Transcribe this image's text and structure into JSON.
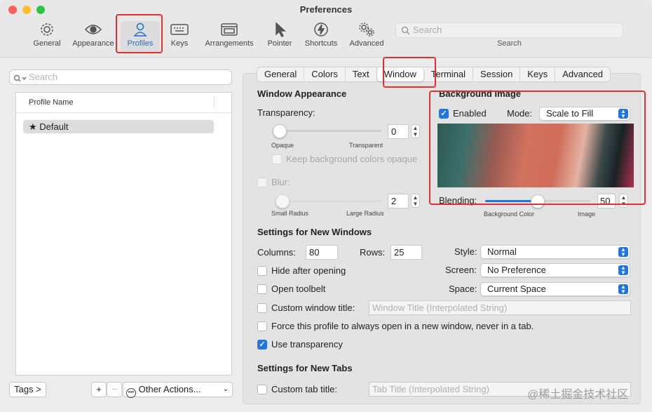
{
  "window": {
    "title": "Preferences"
  },
  "toolbar": {
    "items": [
      {
        "label": "General",
        "icon": "gear-icon"
      },
      {
        "label": "Appearance",
        "icon": "eye-icon"
      },
      {
        "label": "Profiles",
        "icon": "person-icon",
        "selected": true
      },
      {
        "label": "Keys",
        "icon": "keyboard-icon"
      },
      {
        "label": "Arrangements",
        "icon": "windows-icon"
      },
      {
        "label": "Pointer",
        "icon": "pointer-icon"
      },
      {
        "label": "Shortcuts",
        "icon": "lightning-icon"
      },
      {
        "label": "Advanced",
        "icon": "gears-icon"
      }
    ],
    "search": {
      "placeholder": "Search",
      "label": "Search"
    }
  },
  "sidebar": {
    "search_placeholder": "Search",
    "column_header": "Profile Name",
    "profiles": [
      {
        "name": "Default",
        "star": "★"
      }
    ],
    "tags_button": "Tags >",
    "add_button": "+",
    "remove_button": "−",
    "other_actions": "Other Actions..."
  },
  "tabs": [
    "General",
    "Colors",
    "Text",
    "Window",
    "Terminal",
    "Session",
    "Keys",
    "Advanced"
  ],
  "selected_tab": "Window",
  "window_appearance": {
    "heading": "Window Appearance",
    "transparency_label": "Transparency:",
    "transparency_value": "0",
    "opaque": "Opaque",
    "transparent": "Transparent",
    "keep_opaque": "Keep background colors opaque",
    "blur_label": "Blur:",
    "blur_value": "2",
    "small_radius": "Small Radius",
    "large_radius": "Large Radius"
  },
  "background_image": {
    "heading": "Background Image",
    "enabled_label": "Enabled",
    "enabled": true,
    "mode_label": "Mode:",
    "mode_value": "Scale to Fill",
    "blending_label": "Blending:",
    "blending_value": "50",
    "blending_fraction": 0.5,
    "background_color": "Background Color",
    "image": "Image"
  },
  "new_windows": {
    "heading": "Settings for New Windows",
    "columns_label": "Columns:",
    "columns": "80",
    "rows_label": "Rows:",
    "rows": "25",
    "style_label": "Style:",
    "style": "Normal",
    "screen_label": "Screen:",
    "screen": "No Preference",
    "space_label": "Space:",
    "space": "Current Space",
    "hide_after_opening": "Hide after opening",
    "open_toolbelt": "Open toolbelt",
    "custom_title": "Custom window title:",
    "title_placeholder": "Window Title (Interpolated String)",
    "force_window": "Force this profile to always open in a new window, never in a tab.",
    "use_transparency": "Use transparency"
  },
  "new_tabs": {
    "heading": "Settings for New Tabs",
    "custom_tab_title": "Custom tab title:",
    "tab_title_placeholder": "Tab Title (Interpolated String)"
  },
  "watermark": "@稀土掘金技术社区",
  "colors": {
    "accent": "#1f75e3",
    "highlight": "#e0302f",
    "close": "#ff5f57",
    "minimize": "#febc2e",
    "zoom": "#28c840"
  }
}
